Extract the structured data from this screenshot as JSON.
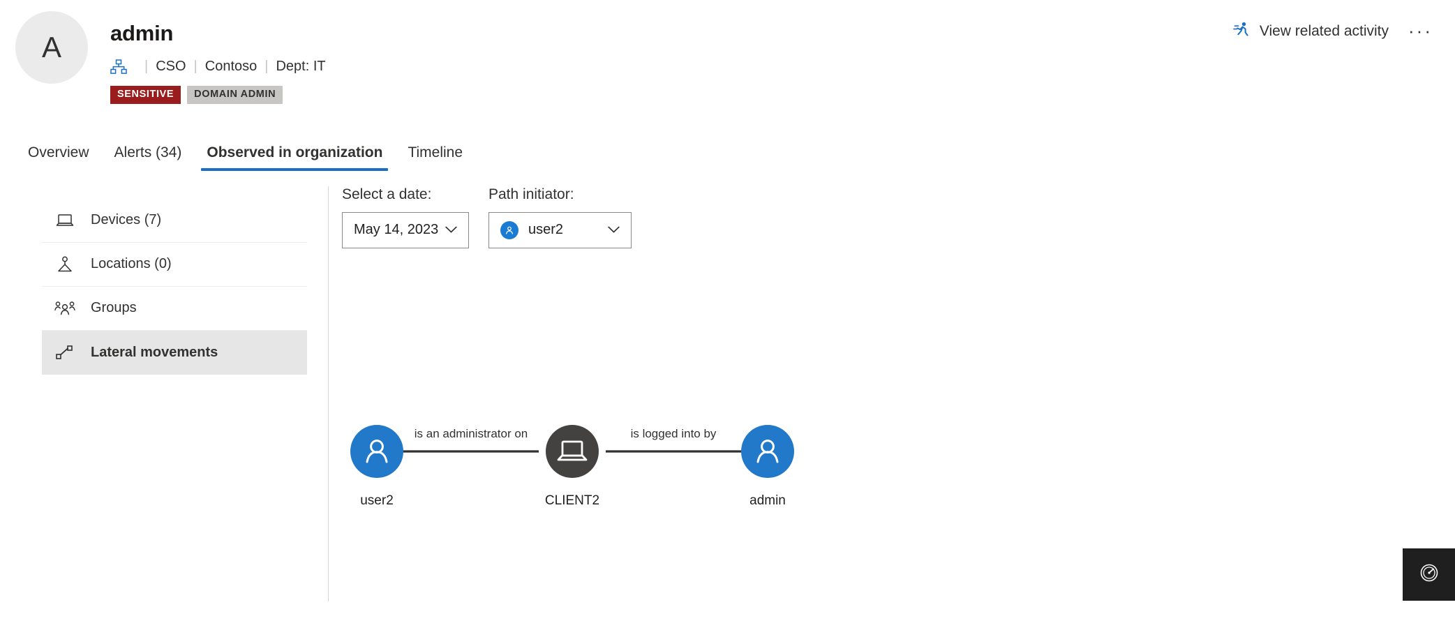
{
  "header": {
    "avatar_initial": "A",
    "title": "admin",
    "meta": {
      "org_icon": "org-chart-icon",
      "items": [
        "CSO",
        "Contoso",
        "Dept: IT"
      ],
      "separator": "|"
    },
    "badges": [
      {
        "label": "SENSITIVE",
        "color": "#9b1c1c",
        "text_color": "#ffffff"
      },
      {
        "label": "DOMAIN ADMIN",
        "color": "#c8c6c4",
        "text_color": "#323130"
      }
    ],
    "actions": {
      "related_activity_icon": "running-person-icon",
      "related_activity_label": "View related activity",
      "more_label": "···"
    }
  },
  "tabs": [
    {
      "label": "Overview",
      "active": false
    },
    {
      "label": "Alerts (34)",
      "active": false
    },
    {
      "label": "Observed in organization",
      "active": true
    },
    {
      "label": "Timeline",
      "active": false
    }
  ],
  "tab_accent_color": "#1a6fc4",
  "sidebar": {
    "items": [
      {
        "label": "Devices (7)",
        "icon": "laptop-icon",
        "selected": false
      },
      {
        "label": "Locations (0)",
        "icon": "location-person-icon",
        "selected": false
      },
      {
        "label": "Groups",
        "icon": "people-group-icon",
        "selected": false
      },
      {
        "label": "Lateral movements",
        "icon": "lateral-movement-icon",
        "selected": true
      }
    ]
  },
  "filters": {
    "date": {
      "label": "Select a date:",
      "value": "May 14, 2023",
      "chevron_icon": "chevron-down-icon"
    },
    "initiator": {
      "label": "Path initiator:",
      "value": "user2",
      "avatar_icon": "user-avatar-icon",
      "chevron_icon": "chevron-down-icon"
    }
  },
  "graph": {
    "nodes": [
      {
        "id": "user2",
        "label": "user2",
        "type": "user",
        "color": "#2279c9",
        "icon": "person-icon"
      },
      {
        "id": "CLIENT2",
        "label": "CLIENT2",
        "type": "device",
        "color": "#444240",
        "icon": "laptop-icon"
      },
      {
        "id": "admin",
        "label": "admin",
        "type": "user",
        "color": "#2279c9",
        "icon": "person-icon"
      }
    ],
    "edges": [
      {
        "from": "user2",
        "to": "CLIENT2",
        "label": "is an administrator on"
      },
      {
        "from": "CLIENT2",
        "to": "admin",
        "label": "is logged into by"
      }
    ],
    "edge_color": "#323130"
  },
  "perf_widget": {
    "icon": "gauge-icon",
    "background": "#1f1f1f"
  }
}
